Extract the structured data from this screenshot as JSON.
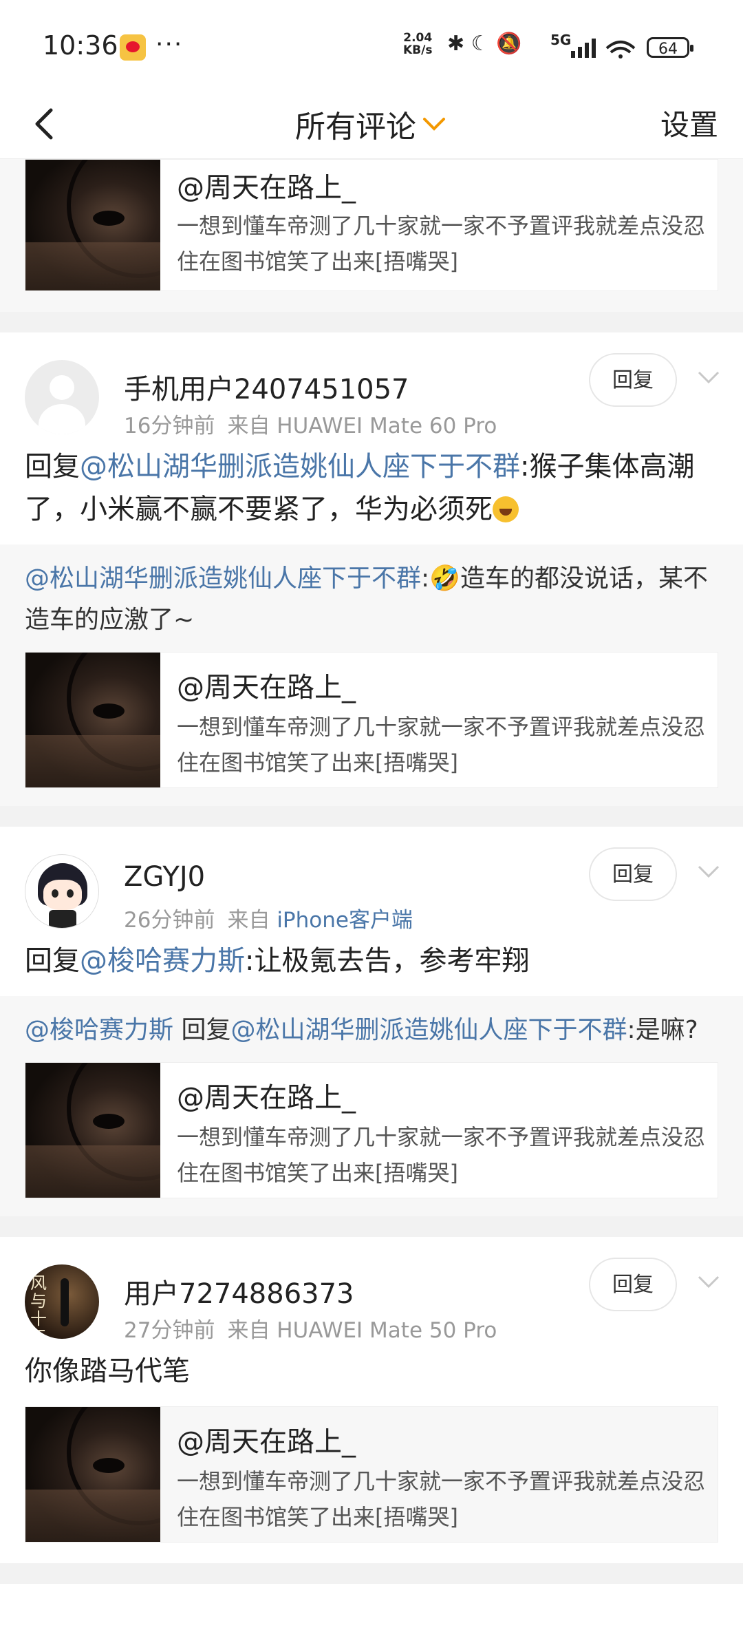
{
  "status_bar": {
    "time": "10:36",
    "more": "···",
    "speed_value": "2.04",
    "speed_unit": "KB/s",
    "signal_label": "5G",
    "battery": "64"
  },
  "header": {
    "title": "所有评论",
    "settings_label": "设置"
  },
  "linked_card": {
    "title": "@周天在路上_",
    "description": "一想到懂车帝测了几十家就一家不予置评我就差点没忍住在图书馆笑了出来[捂嘴哭]"
  },
  "comments": [
    {
      "user": "手机用户2407451057",
      "time": "16分钟前",
      "source": "来自 HUAWEI Mate 60 Pro",
      "reply_label": "回复",
      "text_prefix": "回复",
      "mention": "@松山湖华删派造姚仙人座下于不群",
      "text": ":猴子集体高潮了，小米赢不赢不要紧了，华为必须死",
      "quote_mention": "@松山湖华删派造姚仙人座下于不群",
      "quote_text": ":🤣造车的都没说话，某不造车的应激了~"
    },
    {
      "user": "ZGYJ0",
      "time": "26分钟前",
      "source_prefix": "来自",
      "source_app": "iPhone客户端",
      "reply_label": "回复",
      "text_prefix": "回复",
      "mention": "@梭哈赛力斯",
      "text": ":让极氪去告，参考牢翔",
      "quote_mention": "@梭哈赛力斯",
      "quote_mid": " 回复",
      "quote_mention2": "@松山湖华删派造姚仙人座下于不群",
      "quote_text": ":是嘛?"
    },
    {
      "user": "用户7274886373",
      "avatar_text": "风与十三郎",
      "time": "27分钟前",
      "source": "来自 HUAWEI Mate 50 Pro",
      "reply_label": "回复",
      "text": "你像踏马代笔"
    }
  ],
  "icons": {
    "back": "chevron-left-icon",
    "dropdown": "chevron-down-icon",
    "more": "chevron-down-icon"
  },
  "colors": {
    "accent_orange": "#f39800",
    "mention_blue": "#4a76a8",
    "meta_gray": "#999999",
    "separator": "#f2f2f2"
  }
}
